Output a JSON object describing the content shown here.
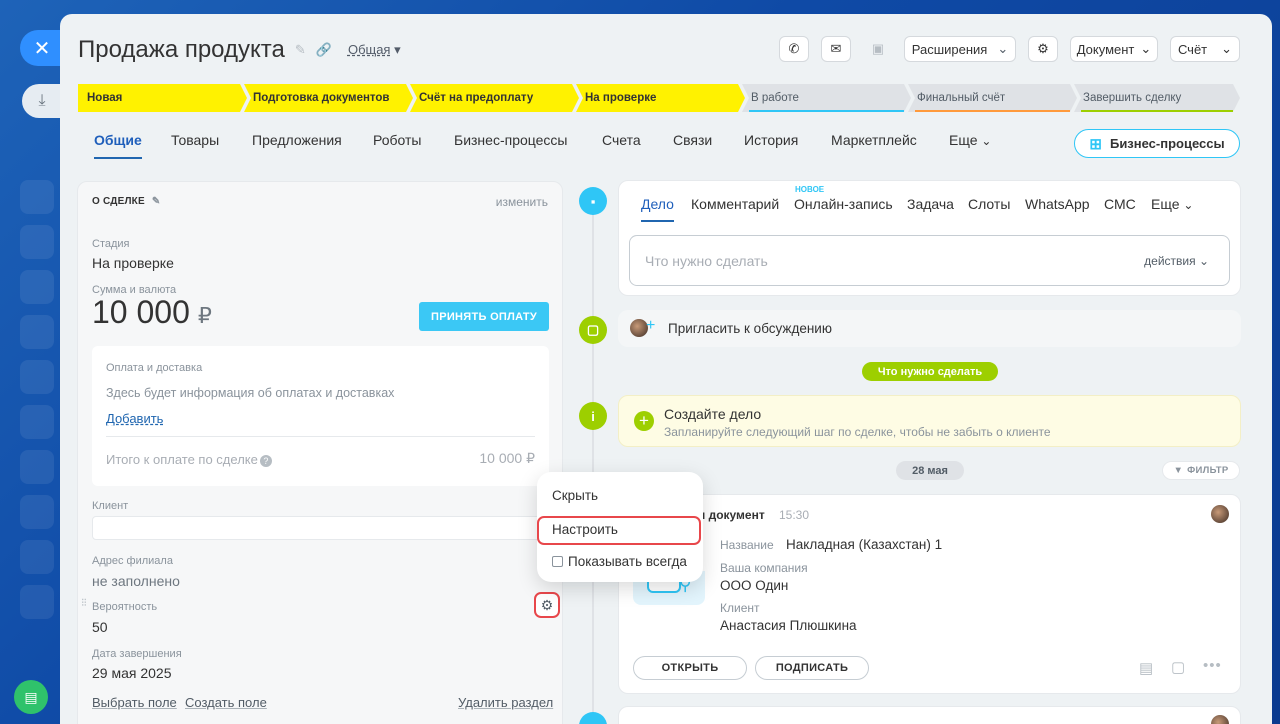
{
  "header": {
    "title": "Продажа продукта",
    "category": "Общая"
  },
  "toolbar": {
    "extensions": "Расширения",
    "document": "Документ",
    "invoice": "Счёт"
  },
  "stages": [
    {
      "label": "Новая",
      "state": "active"
    },
    {
      "label": "Подготовка документов",
      "state": "active"
    },
    {
      "label": "Счёт на предоплату",
      "state": "active"
    },
    {
      "label": "На проверке",
      "state": "active"
    },
    {
      "label": "В работе",
      "state": "inactive",
      "color": "#2fc6f6"
    },
    {
      "label": "Финальный счёт",
      "state": "inactive",
      "color": "#ff9a3c"
    },
    {
      "label": "Завершить сделку",
      "state": "inactive",
      "color": "#9dcf00"
    }
  ],
  "tabs": [
    {
      "label": "Общие",
      "active": true
    },
    {
      "label": "Товары"
    },
    {
      "label": "Предложения"
    },
    {
      "label": "Роботы"
    },
    {
      "label": "Бизнес-процессы"
    },
    {
      "label": "Счета"
    },
    {
      "label": "Связи"
    },
    {
      "label": "История"
    },
    {
      "label": "Маркетплейс"
    },
    {
      "label": "Еще"
    }
  ],
  "bp_button": "Бизнес-процессы",
  "deal": {
    "header": "О СДЕЛКЕ",
    "edit": "изменить",
    "stage_label": "Стадия",
    "stage_value": "На проверке",
    "sum_label": "Сумма и валюта",
    "sum_value": "10 000",
    "currency": "₽",
    "pay_button": "ПРИНЯТЬ ОПЛАТУ",
    "payment": {
      "title": "Оплата и доставка",
      "info": "Здесь будет информация об оплатах и доставках",
      "add": "Добавить",
      "total_label": "Итого к оплате по сделке",
      "total_value": "10 000 ₽"
    },
    "client_label": "Клиент",
    "branch_label": "Адрес филиала",
    "branch_value": "не заполнено",
    "probability_label": "Вероятность",
    "probability_value": "50",
    "close_label": "Дата завершения",
    "close_value": "29 мая 2025",
    "links": {
      "choose": "Выбрать поле",
      "create": "Создать поле",
      "delete": "Удалить раздел"
    }
  },
  "context_menu": {
    "hide": "Скрыть",
    "configure": "Настроить",
    "always_show": "Показывать всегда"
  },
  "timeline": {
    "tabs": [
      "Дело",
      "Комментарий",
      "Онлайн-запись",
      "Задача",
      "Слоты",
      "WhatsApp",
      "СМС",
      "Еще"
    ],
    "new_badge": "НОВОЕ",
    "todo_placeholder": "Что нужно сделать",
    "todo_actions": "действия",
    "invite": "Пригласить к обсуждению",
    "todo_pill": "Что нужно сделать",
    "create_title": "Создайте дело",
    "create_sub": "Запланируйте следующий шаг по сделке, чтобы не забыть о клиенте",
    "date_pill": "28 мая",
    "filter": "ФИЛЬТР",
    "doc": {
      "title": "н документ",
      "time": "15:30",
      "name_label": "Название",
      "name_value": "Накладная (Казахстан) 1",
      "company_label": "Ваша компания",
      "company_value": "ООО Один",
      "client_label": "Клиент",
      "client_value": "Анастасия Плюшкина",
      "open": "ОТКРЫТЬ",
      "sign": "ПОДПИСАТЬ"
    }
  }
}
